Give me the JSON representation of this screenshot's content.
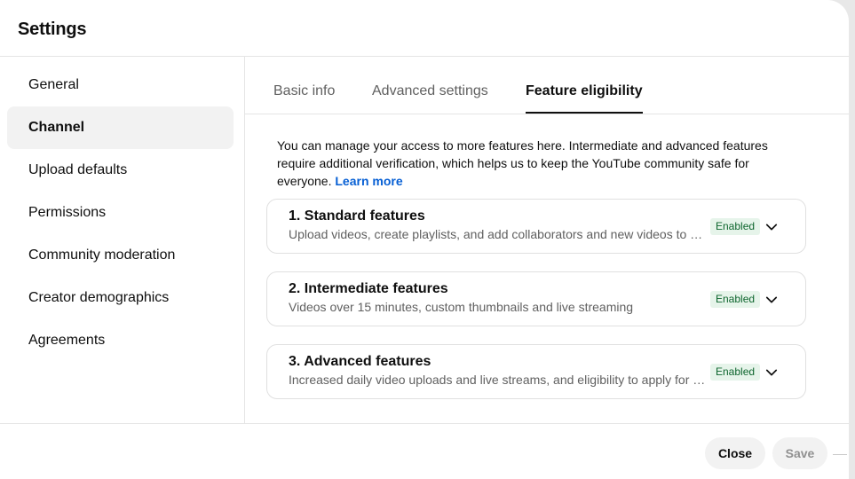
{
  "dialog": {
    "title": "Settings"
  },
  "sidebar": {
    "items": [
      {
        "label": "General",
        "active": false
      },
      {
        "label": "Channel",
        "active": true
      },
      {
        "label": "Upload defaults",
        "active": false
      },
      {
        "label": "Permissions",
        "active": false
      },
      {
        "label": "Community moderation",
        "active": false
      },
      {
        "label": "Creator demographics",
        "active": false
      },
      {
        "label": "Agreements",
        "active": false
      }
    ]
  },
  "tabs": [
    {
      "label": "Basic info",
      "active": false
    },
    {
      "label": "Advanced settings",
      "active": false
    },
    {
      "label": "Feature eligibility",
      "active": true
    }
  ],
  "intro": {
    "text": "You can manage your access to more features here. Intermediate and advanced features require additional verification, which helps us to keep the YouTube community safe for everyone.",
    "link_label": "Learn more"
  },
  "features": [
    {
      "title": "1. Standard features",
      "description": "Upload videos, create playlists, and add collaborators and new videos to playlists",
      "status": "Enabled"
    },
    {
      "title": "2. Intermediate features",
      "description": "Videos over 15 minutes, custom thumbnails and live streaming",
      "status": "Enabled"
    },
    {
      "title": "3. Advanced features",
      "description": "Increased daily video uploads and live streams, and eligibility to apply for monetization",
      "status": "Enabled"
    }
  ],
  "footer": {
    "close_label": "Close",
    "save_label": "Save"
  },
  "icons": {
    "expand": "chevron-down-icon"
  },
  "colors": {
    "accent_link": "#065fd4",
    "badge_bg": "#e6f4ea",
    "badge_text": "#0d652d"
  }
}
